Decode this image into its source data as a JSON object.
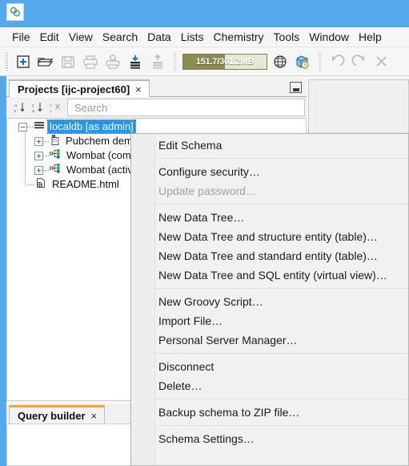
{
  "window": {
    "app_icon": "molecule-icon",
    "titlebar_color": "#54a8ec"
  },
  "menubar": {
    "items": [
      {
        "label": "File"
      },
      {
        "label": "Edit"
      },
      {
        "label": "View"
      },
      {
        "label": "Search"
      },
      {
        "label": "Data"
      },
      {
        "label": "Lists"
      },
      {
        "label": "Chemistry"
      },
      {
        "label": "Tools"
      },
      {
        "label": "Window"
      },
      {
        "label": "Help"
      }
    ]
  },
  "toolbar": {
    "buttons": [
      {
        "name": "new-icon",
        "enabled": true
      },
      {
        "name": "open-folder-icon",
        "enabled": true
      },
      {
        "name": "save-icon",
        "enabled": false
      },
      {
        "name": "print-icon",
        "enabled": false
      },
      {
        "name": "print-preview-icon",
        "enabled": false
      },
      {
        "name": "import-icon",
        "enabled": true
      },
      {
        "name": "export-icon",
        "enabled": false
      },
      {
        "name": "refresh-globe-icon",
        "enabled": true
      },
      {
        "name": "database-history-icon",
        "enabled": true
      },
      {
        "name": "undo-icon",
        "enabled": false
      },
      {
        "name": "redo-icon",
        "enabled": false
      },
      {
        "name": "cut-scissors-icon",
        "enabled": false
      }
    ],
    "memory": {
      "label": "151.7/301.2MB",
      "used_mb": 151.7,
      "total_mb": 301.2,
      "percent": 50,
      "fill_color": "#8c8c4f"
    }
  },
  "projects_panel": {
    "tab": {
      "label": "Projects [ijc-project60]",
      "close_label": "×"
    },
    "dock_button": "minimize-window-icon",
    "search": {
      "placeholder": "Search",
      "value": ""
    },
    "sort_buttons": [
      {
        "name": "sort-ascending-icon",
        "label": "a↓"
      },
      {
        "name": "sort-descending-icon",
        "label": "z↓"
      },
      {
        "name": "sort-clear-icon",
        "label": "a×"
      }
    ],
    "tree": [
      {
        "label": "localdb [as admin]",
        "icon": "schema-icon",
        "selected": true,
        "expanded": true,
        "depth": 0
      },
      {
        "label": "Pubchem demo",
        "icon": "data-tree-icon",
        "selected": false,
        "expanded": false,
        "depth": 1
      },
      {
        "label": "Wombat (comp",
        "icon": "structure-entity-icon",
        "selected": false,
        "expanded": false,
        "depth": 1
      },
      {
        "label": "Wombat (activi",
        "icon": "structure-entity-icon",
        "selected": false,
        "expanded": false,
        "depth": 1
      },
      {
        "label": "README.html",
        "icon": "html-file-icon",
        "selected": false,
        "expanded": null,
        "depth": 1
      }
    ]
  },
  "query_builder_panel": {
    "tab": {
      "label": "Query builder",
      "close_label": "×",
      "accent_color": "#f5a623"
    }
  },
  "context_menu": {
    "items": [
      {
        "label": "Edit Schema",
        "disabled": false
      },
      {
        "separator": true
      },
      {
        "label": "Configure security…",
        "disabled": false
      },
      {
        "label": "Update password…",
        "disabled": true
      },
      {
        "separator": true
      },
      {
        "label": "New Data Tree…",
        "disabled": false
      },
      {
        "label": "New Data Tree and structure entity (table)…",
        "disabled": false
      },
      {
        "label": "New Data Tree and standard entity (table)…",
        "disabled": false
      },
      {
        "label": "New Data Tree and SQL entity (virtual view)…",
        "disabled": false
      },
      {
        "separator": true
      },
      {
        "label": "New Groovy Script…",
        "disabled": false
      },
      {
        "label": "Import File…",
        "disabled": false
      },
      {
        "label": "Personal Server Manager…",
        "disabled": false
      },
      {
        "separator": true
      },
      {
        "label": "Disconnect",
        "disabled": false
      },
      {
        "label": "Delete…",
        "disabled": false
      },
      {
        "separator": true
      },
      {
        "label": "Backup schema to ZIP file…",
        "disabled": false
      },
      {
        "separator": true
      },
      {
        "label": "Schema Settings…",
        "disabled": false
      }
    ]
  }
}
